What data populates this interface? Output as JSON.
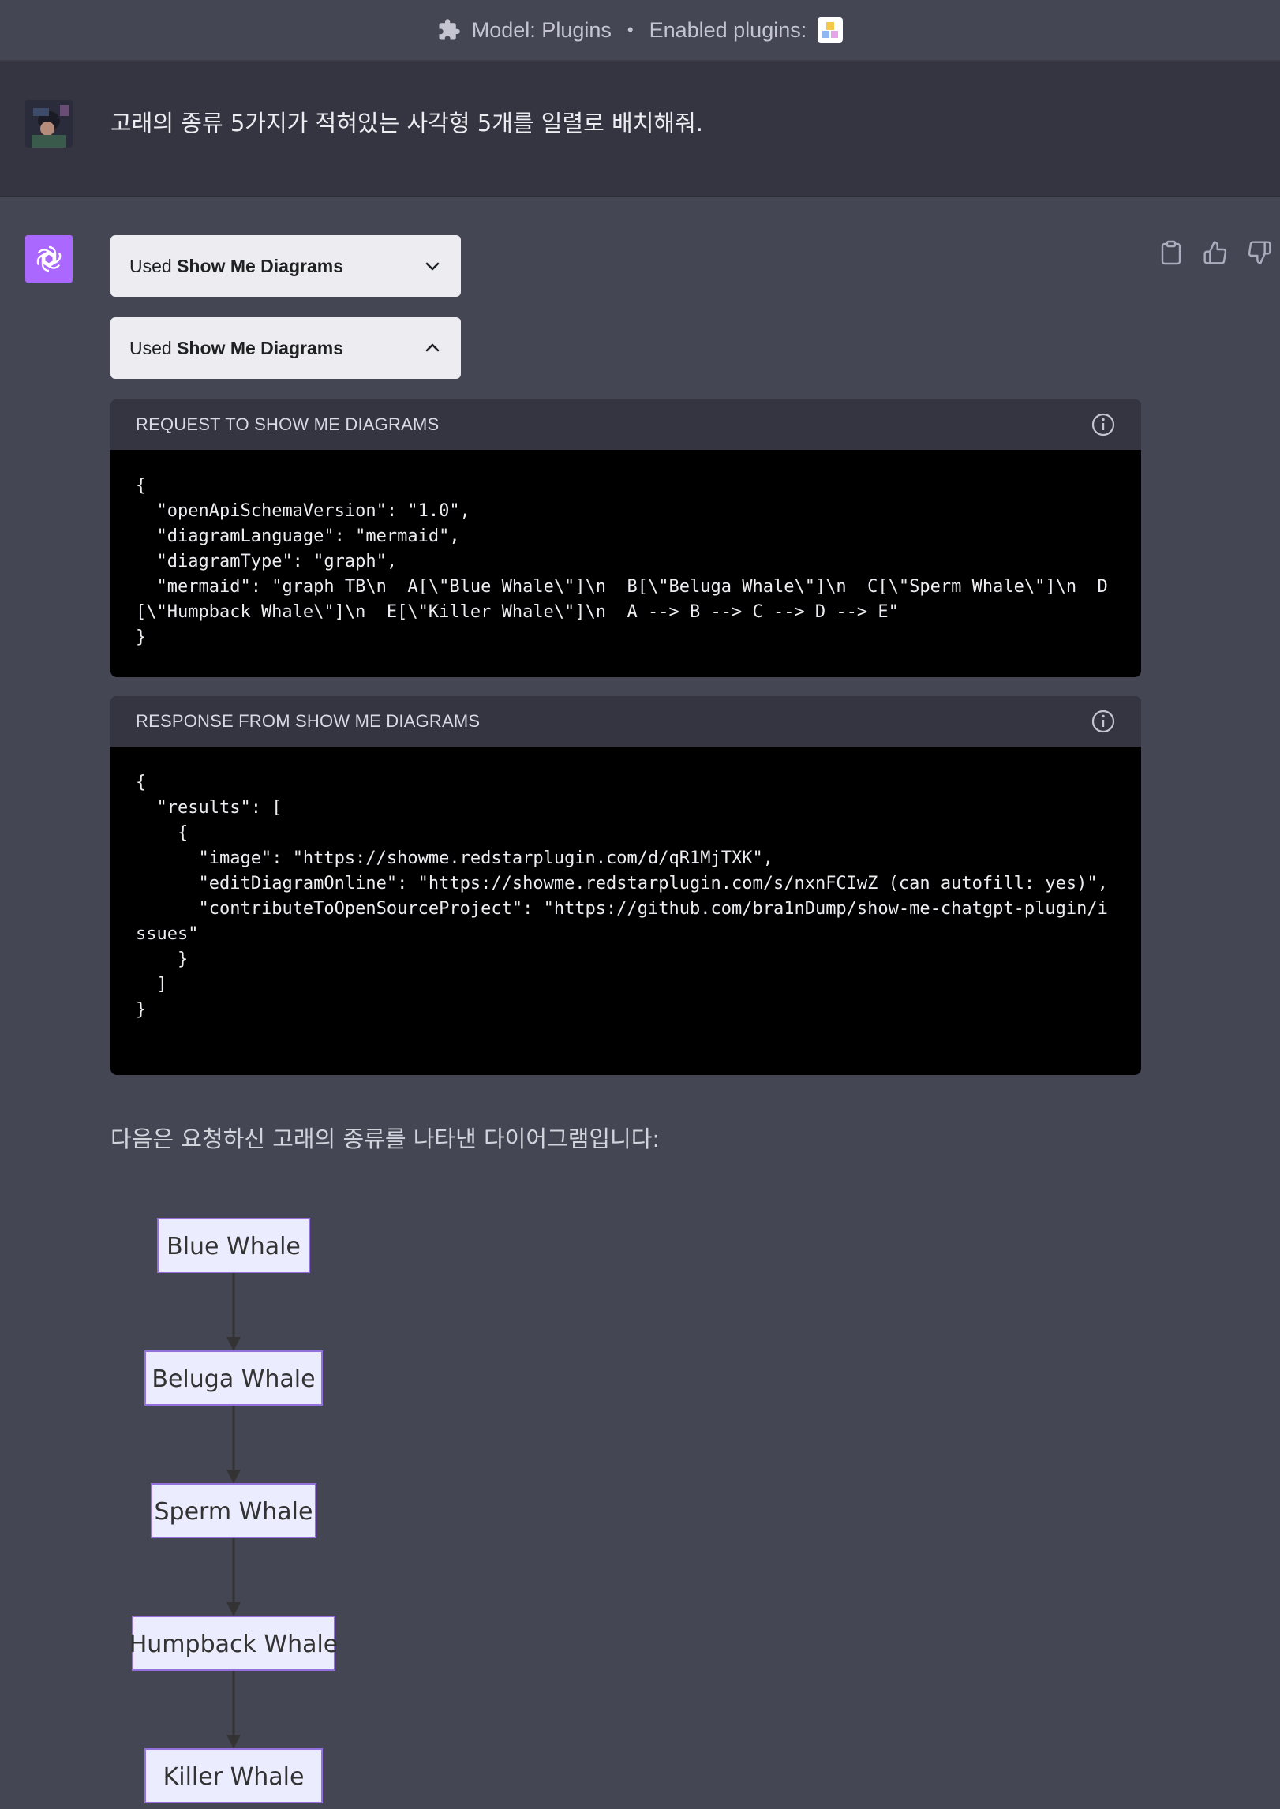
{
  "topbar": {
    "model_text": "Model: Plugins",
    "separator": "•",
    "enabled_text": "Enabled plugins:"
  },
  "user_message": "고래의 종류 5가지가 적혀있는 사각형 5개를 일렬로 배치해줘.",
  "plugin_calls": [
    {
      "prefix": "Used",
      "name": "Show Me Diagrams",
      "expanded": false
    },
    {
      "prefix": "Used",
      "name": "Show Me Diagrams",
      "expanded": true
    }
  ],
  "request_panel": {
    "title": "REQUEST TO SHOW ME DIAGRAMS",
    "code": "{\n  \"openApiSchemaVersion\": \"1.0\",\n  \"diagramLanguage\": \"mermaid\",\n  \"diagramType\": \"graph\",\n  \"mermaid\": \"graph TB\\n  A[\\\"Blue Whale\\\"]\\n  B[\\\"Beluga Whale\\\"]\\n  C[\\\"Sperm Whale\\\"]\\n  D[\\\"Humpback Whale\\\"]\\n  E[\\\"Killer Whale\\\"]\\n  A --> B --> C --> D --> E\"\n}"
  },
  "response_panel": {
    "title": "RESPONSE FROM SHOW ME DIAGRAMS",
    "code": "{\n  \"results\": [\n    {\n      \"image\": \"https://showme.redstarplugin.com/d/qR1MjTXK\",\n      \"editDiagramOnline\": \"https://showme.redstarplugin.com/s/nxnFCIwZ (can autofill: yes)\",\n      \"contributeToOpenSourceProject\": \"https://github.com/bra1nDump/show-me-chatgpt-plugin/issues\"\n    }\n  ]\n}"
  },
  "answer_text": "다음은 요청하신 고래의 종류를 나타낸 다이어그램입니다:",
  "diagram": {
    "nodes": [
      "Blue Whale",
      "Beluga Whale",
      "Sperm Whale",
      "Humpback Whale",
      "Killer Whale"
    ]
  },
  "colors": {
    "background": "#444654",
    "user_background": "#343541",
    "assistant_icon": "#ab68ff",
    "node_fill": "#ECECFF",
    "node_border": "#9370DB",
    "edge": "#333333"
  },
  "icons": {
    "topbar": "puzzle-icon",
    "actions": [
      "clipboard-icon",
      "thumbs-up-icon",
      "thumbs-down-icon"
    ]
  }
}
